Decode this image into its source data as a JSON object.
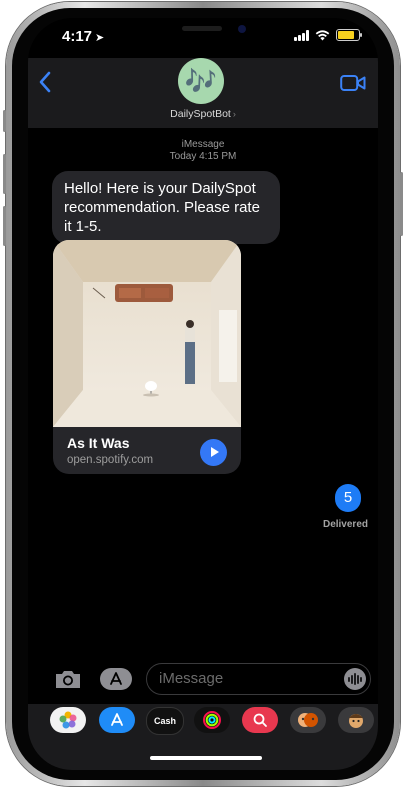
{
  "status_bar": {
    "time": "4:17"
  },
  "header": {
    "back_icon": "chevron-left-icon",
    "avatar_glyph": "🎶",
    "contact_name": "DailySpotBot",
    "contact_chevron": "›",
    "video_icon": "video-camera-icon"
  },
  "thread": {
    "service": "iMessage",
    "timestamp": "Today 4:15 PM",
    "incoming_message": "Hello! Here is your DailySpot recommendation. Please rate it 1-5.",
    "link_preview": {
      "title": "As It Was",
      "url": "open.spotify.com"
    },
    "outgoing_message": "5",
    "delivery_status": "Delivered"
  },
  "composer": {
    "placeholder": "iMessage"
  },
  "app_drawer": {
    "items": [
      {
        "name": "photos-app-icon",
        "label": ""
      },
      {
        "name": "app-store-icon",
        "label": ""
      },
      {
        "name": "apple-cash-icon",
        "label": "Cash"
      },
      {
        "name": "activity-icon",
        "label": ""
      },
      {
        "name": "search-images-icon",
        "label": ""
      },
      {
        "name": "memoji-stickers-icon",
        "label": ""
      },
      {
        "name": "animoji-icon",
        "label": ""
      }
    ]
  },
  "colors": {
    "accent": "#3b82f6",
    "outgoing_bubble": "#1e7cf6",
    "incoming_bubble": "#26262a",
    "header_bg": "#1b1b1d"
  }
}
